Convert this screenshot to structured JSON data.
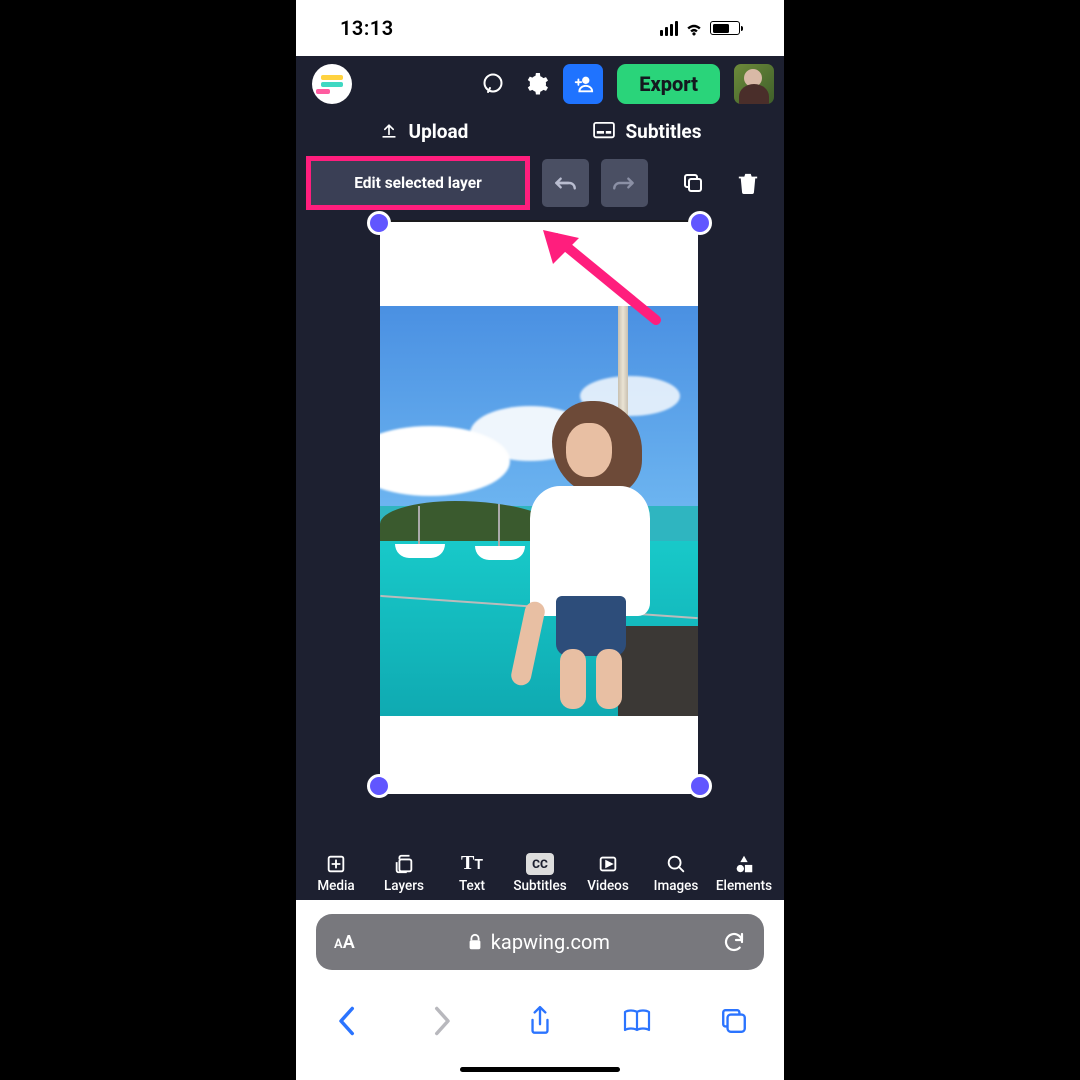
{
  "statusbar": {
    "time": "13:13"
  },
  "topbar": {
    "export_label": "Export"
  },
  "subbar": {
    "upload_label": "Upload",
    "subtitles_label": "Subtitles"
  },
  "toolbar": {
    "edit_selected_label": "Edit selected layer"
  },
  "bottom_tabs": {
    "media": "Media",
    "layers": "Layers",
    "text": "Text",
    "subtitles": "Subtitles",
    "subtitles_badge": "CC",
    "videos": "Videos",
    "images": "Images",
    "elements": "Elements"
  },
  "browser": {
    "text_size_label": "AA",
    "url": "kapwing.com"
  }
}
